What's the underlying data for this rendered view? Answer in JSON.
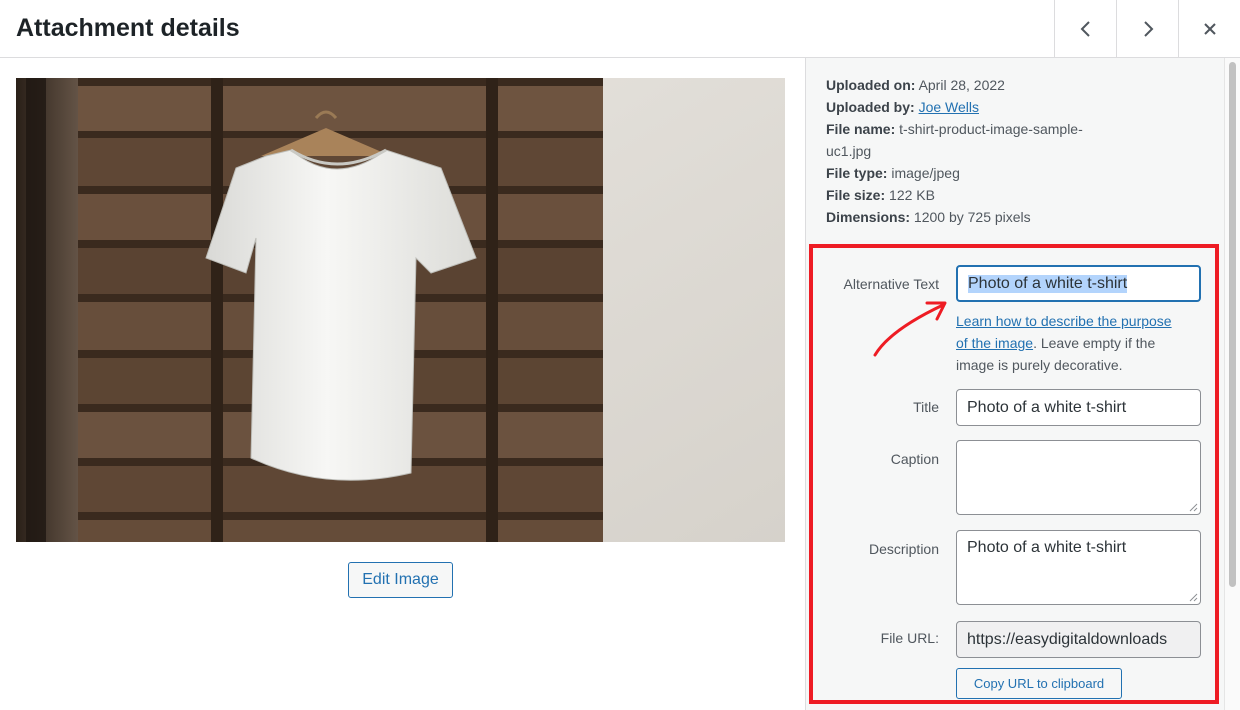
{
  "header": {
    "title": "Attachment details",
    "prev_icon": "chevron-left-icon",
    "next_icon": "chevron-right-icon",
    "close_icon": "close-icon"
  },
  "preview": {
    "edit_button": "Edit Image"
  },
  "details": {
    "uploaded_on_label": "Uploaded on:",
    "uploaded_on_value": "April 28, 2022",
    "uploaded_by_label": "Uploaded by:",
    "uploaded_by_value": "Joe Wells",
    "file_name_label": "File name:",
    "file_name_value": "t-shirt-product-image-sample-",
    "file_name_value_2": "uc1.jpg",
    "file_type_label": "File type:",
    "file_type_value": "image/jpeg",
    "file_size_label": "File size:",
    "file_size_value": "122 KB",
    "dimensions_label": "Dimensions:",
    "dimensions_value": "1200 by 725 pixels"
  },
  "fields": {
    "alt_label": "Alternative Text",
    "alt_value": "Photo of a white t-shirt",
    "alt_help_link_1": "Learn how to describe the purpose",
    "alt_help_link_2": "of the image",
    "alt_help_text_1": ". Leave empty if the",
    "alt_help_text_2": "image is purely decorative.",
    "title_label": "Title",
    "title_value": "Photo of a white t-shirt",
    "caption_label": "Caption",
    "caption_value": "",
    "description_label": "Description",
    "description_value": "Photo of a white t-shirt",
    "file_url_label": "File URL:",
    "file_url_value": "https://easydigitaldownloads",
    "copy_button": "Copy URL to clipboard"
  },
  "colors": {
    "highlight": "#ee1c24",
    "link": "#2271b1",
    "selection": "#b3d4fc"
  }
}
